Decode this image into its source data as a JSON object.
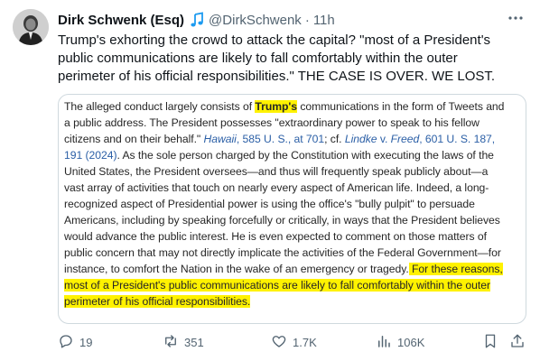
{
  "author": {
    "name": "Dirk Schwenk (Esq)",
    "emoji_icon": "music-note-icon",
    "handle": "@DirkSchwenk",
    "separator": "·",
    "time": "11h"
  },
  "tweet": {
    "lines": [
      "Trump's exhorting the crowd to attack the capital? \"most of a President's",
      "public communications are likely to fall comfortably within the outer",
      "perimeter of his official responsibilities.\"  THE CASE IS OVER.  WE LOST."
    ]
  },
  "document": {
    "line1_pre": "The alleged conduct largely consists of ",
    "line1_highlight": "Trump's",
    "line1_post": " communications in the form of Tweets and",
    "line2": "a public address. The President possesses \"extraordinary power to speak to his fellow",
    "line3_pre": "citizens and on their behalf.\" ",
    "line3_cite1": "Hawaii",
    "line3_cite1b": ", 585 U. S., at 701",
    "line3_mid": "; cf. ",
    "line3_cite2": "Lindke",
    "line3_v": " v. ",
    "line3_cite3": "Freed",
    "line3_cite3b": ", 601 U. S. 187,",
    "line4_cite": "191 (2024)",
    "line4_post": ". As the sole person charged by the Constitution with executing the laws of the",
    "line5": "United States, the President oversees—and thus will frequently speak publicly about—a",
    "line6": "vast array of activities that touch on nearly every aspect of American life. Indeed, a long-",
    "line7": "recognized aspect of Presidential power is using the office's \"bully pulpit\" to persuade",
    "line8": "Americans, including by speaking forcefully or critically, in ways that the President believes",
    "line9": "would advance the public interest. He is even expected to comment on those matters of",
    "line10": "public concern that may not directly implicate the activities of the Federal Government—for",
    "line11_pre": "instance, to comfort the Nation in the wake of an emergency or tragedy.",
    "line11_highlight": " For these reasons,",
    "line12_highlight": "most of a President's public communications are likely to fall comfortably within the outer",
    "line13_highlight": "perimeter of his official responsibilities."
  },
  "actions": {
    "replies": "19",
    "reposts": "351",
    "likes": "1.7K",
    "views": "106K"
  },
  "colors": {
    "highlight": "#fff200",
    "link": "#2b5fa6",
    "secondary_text": "#536471",
    "note_icon": "#1d9bf0"
  }
}
